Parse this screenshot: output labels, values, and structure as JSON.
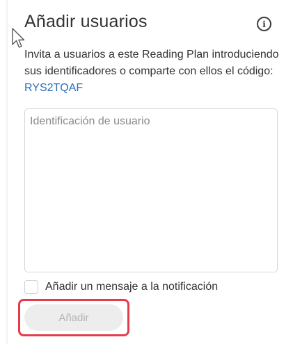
{
  "panel": {
    "title": "Añadir usuarios",
    "info_icon": "info-circle-icon",
    "description_text": "Invita a usuarios a este Reading Plan introduciendo sus identificadores o comparte con ellos el código: ",
    "code": "RYS2TQAF"
  },
  "user_input": {
    "placeholder": "Identificación de usuario",
    "value": ""
  },
  "message_option": {
    "label": "Añadir un mensaje a la notificación",
    "checked": false
  },
  "add_button": {
    "label": "Añadir",
    "enabled": false
  },
  "colors": {
    "link": "#2a6fb8",
    "highlight": "#e53c4a",
    "disabled_button_bg": "#ededed",
    "disabled_button_text": "#b4b4b4"
  }
}
